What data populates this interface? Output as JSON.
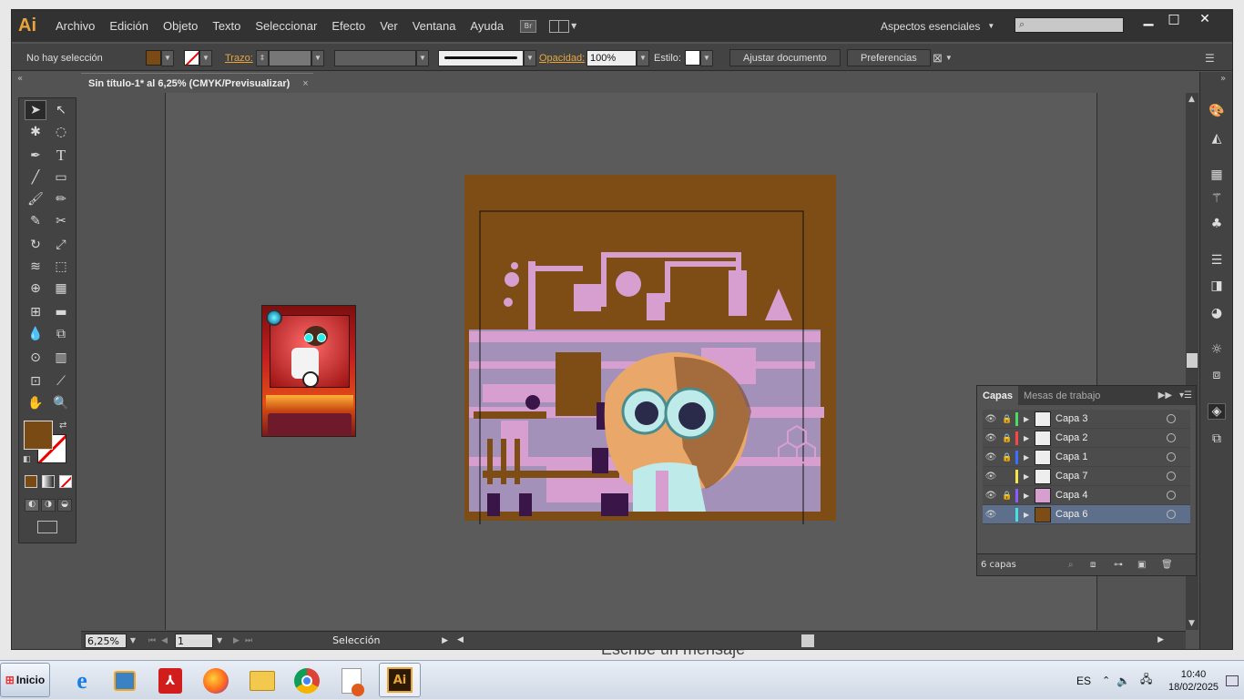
{
  "app": {
    "logo": "Ai"
  },
  "menu": [
    "Archivo",
    "Edición",
    "Objeto",
    "Texto",
    "Seleccionar",
    "Efecto",
    "Ver",
    "Ventana",
    "Ayuda"
  ],
  "menu_icons": {
    "bridge": "Br",
    "arrange": "arrange-documents-icon"
  },
  "workspace": {
    "label": "Aspectos esenciales"
  },
  "window_controls": {
    "minimize": "▁",
    "maximize": "□",
    "close": "✕"
  },
  "control_bar": {
    "selection_status": "No hay selección",
    "stroke_label": "Trazo:",
    "opacity_label": "Opacidad:",
    "opacity_value": "100%",
    "style_label": "Estilo:",
    "fit_document_button": "Ajustar documento",
    "preferences_button": "Preferencias"
  },
  "document": {
    "tab_title": "Sin título-1* al 6,25% (CMYK/Previsualizar)",
    "tab_close": "×"
  },
  "status_bar": {
    "zoom": "6,25%",
    "artboard_number": "1",
    "tool": "Selección"
  },
  "colors": {
    "fill": "#7a4a14",
    "artwork_brown": "#7d4d15",
    "artwork_pink": "#d79fd0",
    "artwork_lavender": "#a795c3",
    "selected_layer": "#5d6f8a"
  },
  "layers_panel": {
    "tabs": [
      "Capas",
      "Mesas de trabajo"
    ],
    "layers": [
      {
        "name": "Capa 3",
        "locked": true,
        "color": "#4cd964"
      },
      {
        "name": "Capa 2",
        "locked": true,
        "color": "#ff4444"
      },
      {
        "name": "Capa 1",
        "locked": true,
        "color": "#3b6fff"
      },
      {
        "name": "Capa 7",
        "locked": false,
        "color": "#f5e54a"
      },
      {
        "name": "Capa 4",
        "locked": true,
        "color": "#8a5cff"
      },
      {
        "name": "Capa 6",
        "locked": false,
        "color": "#44e0e0"
      }
    ],
    "count": "6 capas"
  },
  "taskbar": {
    "start_label": "Inicio",
    "language": "ES",
    "time": "10:40",
    "date": "18/02/2025",
    "behind_text": "Escribe un mensaje"
  }
}
